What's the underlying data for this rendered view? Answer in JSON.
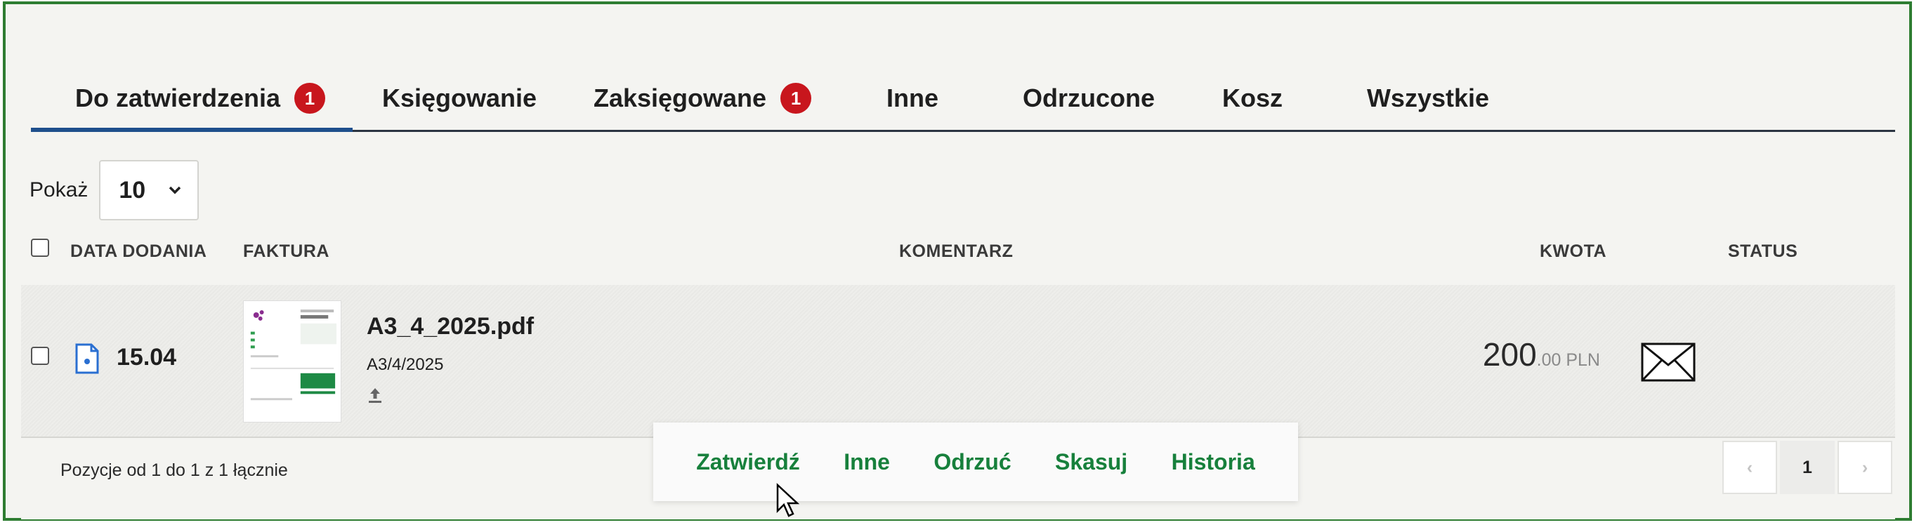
{
  "tabs": [
    {
      "label": "Do zatwierdzenia",
      "badge": "1"
    },
    {
      "label": "Księgowanie"
    },
    {
      "label": "Zaksięgowane",
      "badge": "1"
    },
    {
      "label": "Inne"
    },
    {
      "label": "Odrzucone"
    },
    {
      "label": "Kosz"
    },
    {
      "label": "Wszystkie"
    }
  ],
  "page_size": {
    "label": "Pokaż",
    "value": "10"
  },
  "table": {
    "columns": [
      "DATA DODANIA",
      "FAKTURA",
      "KOMENTARZ",
      "KWOTA",
      "STATUS"
    ],
    "rows": [
      {
        "date": "15.04",
        "file_name": "A3_4_2025.pdf",
        "invoice_number": "A3/4/2025",
        "amount_main": "200",
        "amount_cents": ".00 PLN",
        "status_icon": "envelope-icon"
      }
    ]
  },
  "summary": "Pozycje od 1 do 1 z 1 łącznie",
  "row_actions": [
    "Zatwierdź",
    "Inne",
    "Odrzuć",
    "Skasuj",
    "Historia"
  ],
  "pagination": {
    "prev": "‹",
    "current": "1",
    "next": "›"
  },
  "colors": {
    "accent_green": "#17803c",
    "badge_red": "#c8161d",
    "tab_underline": "#1e4f8c",
    "frame": "#2e7d32"
  }
}
